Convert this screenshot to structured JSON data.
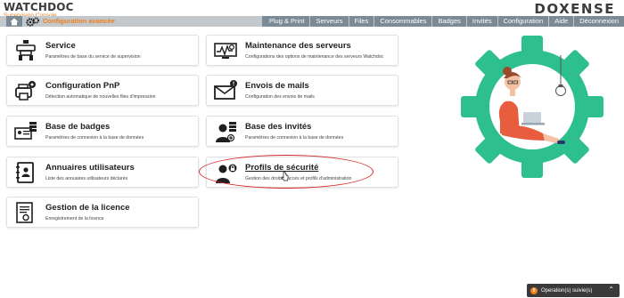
{
  "header": {
    "brand_name": "WATCHDOC",
    "brand_subtitle": "Supervision Console",
    "company": "DOXENSE",
    "active_section": "Configuration avancée"
  },
  "nav": {
    "links": [
      "Plug & Print",
      "Serveurs",
      "Files",
      "Consommables",
      "Badges",
      "Invités",
      "Configuration",
      "Aide",
      "Déconnexion"
    ]
  },
  "cards": {
    "service": {
      "title": "Service",
      "subtitle": "Paramètres de base du service de supervision"
    },
    "maintenance": {
      "title": "Maintenance des serveurs",
      "subtitle": "Configurations des options de maintenance des serveurs Watchdoc"
    },
    "pnp": {
      "title": "Configuration PnP",
      "subtitle": "Détection automatique de nouvelles files d'impression"
    },
    "mails": {
      "title": "Envois de mails",
      "subtitle": "Configuration des envois de mails"
    },
    "badges": {
      "title": "Base de badges",
      "subtitle": "Paramètres de connexion à la base de données"
    },
    "invites": {
      "title": "Base des invités",
      "subtitle": "Paramètres de connexion à la base de données"
    },
    "annuaires": {
      "title": "Annuaires utilisateurs",
      "subtitle": "Liste des annuaires utilisateurs déclarés"
    },
    "profils": {
      "title": "Profils de sécurité",
      "subtitle": "Gestion des droits d'accès et profils d'administration"
    },
    "licence": {
      "title": "Gestion de la licence",
      "subtitle": "Enregistrement de la licence"
    }
  },
  "toast": {
    "count": "0",
    "text": "Operation(s) suivie(s)"
  },
  "colors": {
    "accent": "#f07f1d",
    "nav_bg": "#7b8a94",
    "annotation": "#d9262c",
    "gear": "#2ebf8e"
  }
}
